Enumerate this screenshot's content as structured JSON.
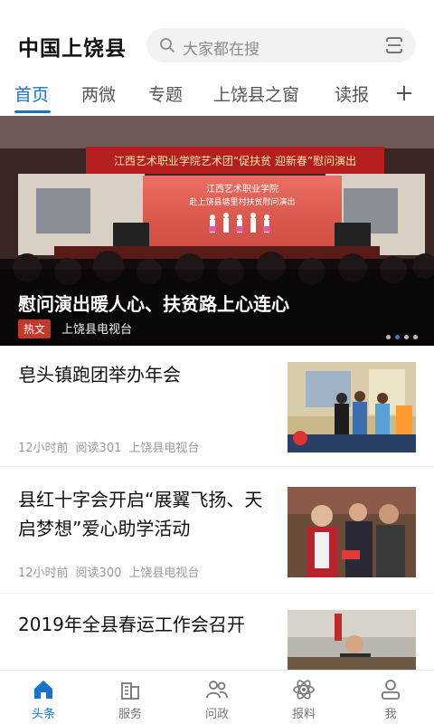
{
  "header": {
    "title": "中国上饶县",
    "search_placeholder": "大家都在搜"
  },
  "tabs": [
    {
      "label": "首页",
      "active": true
    },
    {
      "label": "两微",
      "active": false
    },
    {
      "label": "专题",
      "active": false
    },
    {
      "label": "上饶县之窗",
      "active": false
    },
    {
      "label": "读报",
      "active": false
    }
  ],
  "banner": {
    "title": "慰问演出暖人心、扶贫路上心连心",
    "tag": "热文",
    "source": "上饶县电视台",
    "banner_text": "江西艺术职业学院艺术团“促扶贫 迎新春”慰问演出",
    "stage_text_1": "江西艺术职业学院",
    "stage_text_2": "赴上饶县塘里村扶贫慰问演出",
    "slide_count": 4,
    "active_slide": 2
  },
  "news": [
    {
      "title": "皂头镇跑团举办年会",
      "time": "12小时前",
      "reads": "阅读301",
      "source": "上饶县电视台"
    },
    {
      "title": "县红十字会开启“展翼飞扬、天启梦想”爱心助学活动",
      "time": "12小时前",
      "reads": "阅读300",
      "source": "上饶县电视台"
    },
    {
      "title": "2019年全县春运工作会召开",
      "time": "",
      "reads": "",
      "source": ""
    }
  ],
  "bottom_nav": [
    {
      "label": "头条",
      "icon": "home-icon",
      "active": true
    },
    {
      "label": "服务",
      "icon": "building-icon",
      "active": false
    },
    {
      "label": "问政",
      "icon": "people-icon",
      "active": false
    },
    {
      "label": "报料",
      "icon": "atom-icon",
      "active": false
    },
    {
      "label": "我",
      "icon": "user-icon",
      "active": false
    }
  ],
  "colors": {
    "accent": "#1a73c8",
    "tag_red": "#c0392b"
  }
}
